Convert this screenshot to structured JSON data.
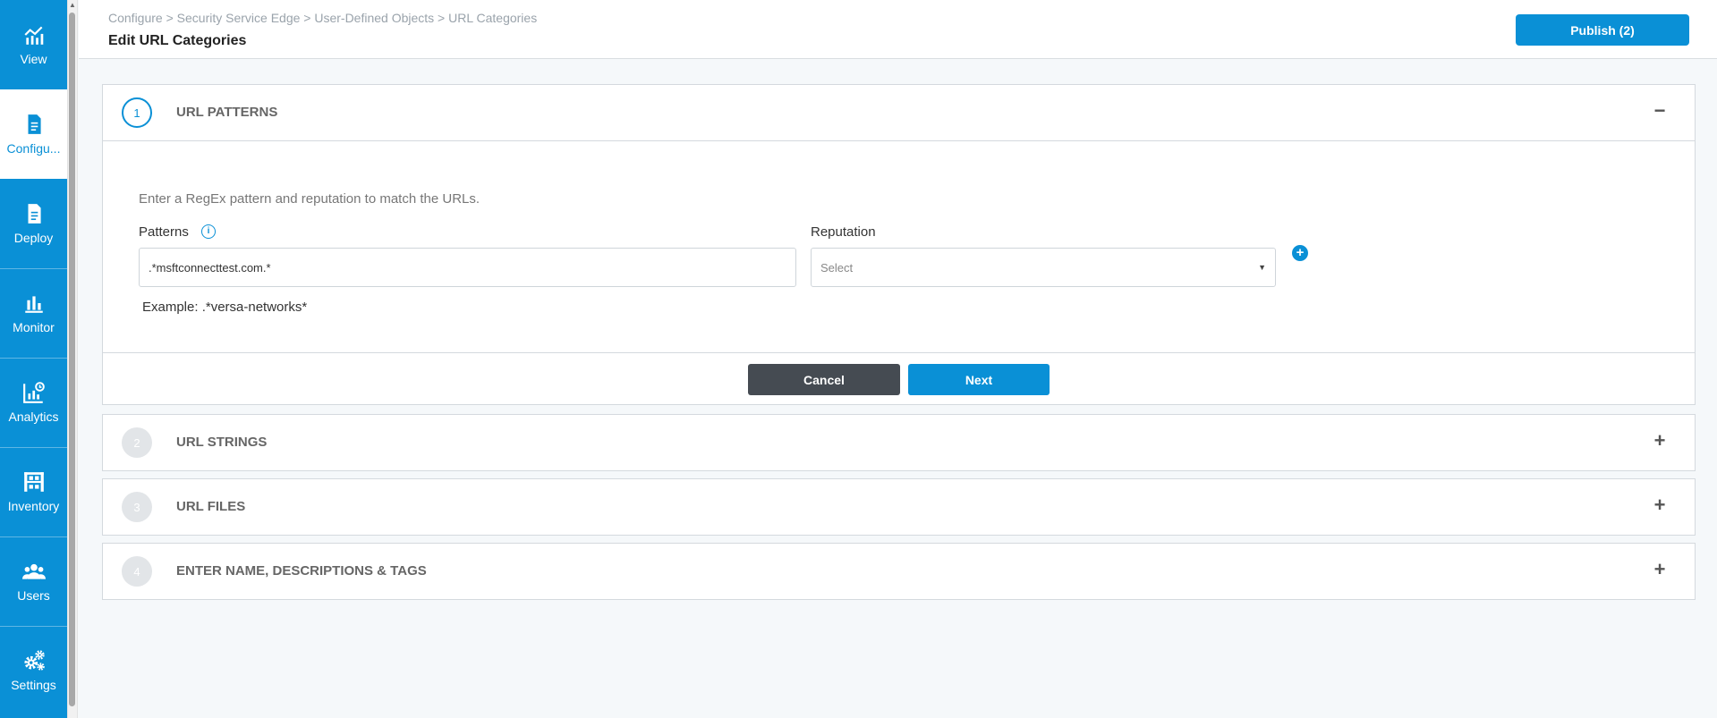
{
  "sidebar": {
    "items": [
      {
        "label": "View",
        "icon": "chart-icon"
      },
      {
        "label": "Configu...",
        "icon": "document-icon"
      },
      {
        "label": "Deploy",
        "icon": "document-icon"
      },
      {
        "label": "Monitor",
        "icon": "bar-chart-icon"
      },
      {
        "label": "Analytics",
        "icon": "analytics-icon"
      },
      {
        "label": "Inventory",
        "icon": "inventory-icon"
      },
      {
        "label": "Users",
        "icon": "users-icon"
      },
      {
        "label": "Settings",
        "icon": "gears-icon"
      }
    ],
    "active_index": 1
  },
  "header": {
    "breadcrumb": "Configure > Security Service Edge > User-Defined Objects > URL Categories",
    "title": "Edit URL Categories",
    "publish_label": "Publish (2)"
  },
  "steps": [
    {
      "number": "1",
      "title": "URL PATTERNS",
      "expanded": true
    },
    {
      "number": "2",
      "title": "URL STRINGS",
      "expanded": false
    },
    {
      "number": "3",
      "title": "URL FILES",
      "expanded": false
    },
    {
      "number": "4",
      "title": "ENTER NAME, DESCRIPTIONS & TAGS",
      "expanded": false
    }
  ],
  "url_patterns": {
    "intro": "Enter a RegEx pattern and reputation to match the URLs.",
    "patterns_label": "Patterns",
    "pattern_value": ".*msftconnecttest.com.*",
    "reputation_label": "Reputation",
    "reputation_placeholder": "Select",
    "example": "Example: .*versa-networks*"
  },
  "actions": {
    "cancel_label": "Cancel",
    "next_label": "Next"
  },
  "colors": {
    "brand": "#0a90d6",
    "cancel": "#454b52"
  }
}
